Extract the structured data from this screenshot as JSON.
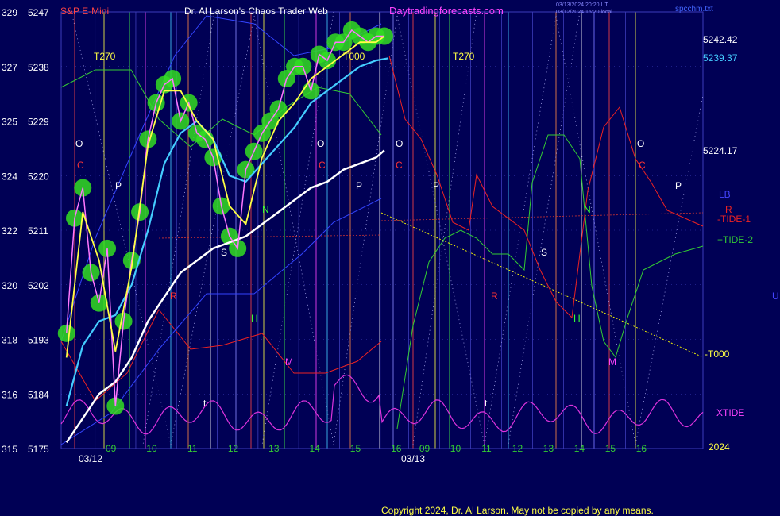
{
  "header": {
    "symbol": "S&P E-Mini",
    "title": "Dr. Al Larson's Chaos Trader Web",
    "site": "Daytradingforecasts.com",
    "timestamp_line1": "03/13/2024 20:20 UT",
    "timestamp_line2": "03/12/2024 16:20 local",
    "filename": "spcchm.txt"
  },
  "footer": {
    "copyright": "Copyright 2024, Dr. Al Larson. May not be copied by any means."
  },
  "colors": {
    "background": "#000055",
    "grid": "#3d3dbb",
    "price": "#ff77ff",
    "ma_fast": "#ffff44",
    "ma_mid": "#44ccff",
    "ma_slow": "#ffffff",
    "tide1": "#ee2222",
    "tide2": "#33cc33",
    "xtide": "#dd33dd",
    "t000": "#ffff00",
    "glow": "#33dd22",
    "axis_text": "#ffffff",
    "header_red": "#ff4444",
    "header_site": "#ff44ff"
  },
  "chart_data": {
    "type": "line",
    "title": "S&P E-Mini",
    "y_left_outer_ticks": [
      "329",
      "327",
      "325",
      "324",
      "322",
      "320",
      "318",
      "316",
      "315"
    ],
    "y_left_inner_ticks": [
      "5247",
      "5238",
      "5229",
      "5220",
      "5211",
      "5202",
      "5193",
      "5184",
      "5175"
    ],
    "ylim": [
      5175,
      5247
    ],
    "x_hour_ticks": [
      "09",
      "10",
      "11",
      "12",
      "13",
      "14",
      "15",
      "16",
      "09",
      "10",
      "11",
      "12",
      "13",
      "14",
      "15",
      "16"
    ],
    "x_date_labels": [
      "03/12",
      "03/13"
    ],
    "x_ticks_days": [
      {
        "date": "03/12",
        "hours": [
          9,
          10,
          11,
          12,
          13,
          14,
          15,
          16
        ]
      },
      {
        "date": "03/13",
        "hours": [
          9,
          10,
          11,
          12,
          13,
          14,
          15,
          16
        ]
      }
    ],
    "right_labels": [
      {
        "text": "5242.42",
        "value": 5242.42,
        "color": "#ffffff"
      },
      {
        "text": "5239.37",
        "value": 5239.37,
        "color": "#44ccff"
      },
      {
        "text": "5224.17",
        "value": 5224.17,
        "color": "#ffffff"
      },
      {
        "text": "LB",
        "color": "#4444ff"
      },
      {
        "text": "R",
        "color": "#ee2222"
      },
      {
        "text": "-TIDE-1",
        "color": "#ee2222"
      },
      {
        "text": "+TIDE-2",
        "color": "#33cc33"
      },
      {
        "text": "U",
        "color": "#4444ff"
      },
      {
        "text": "-T000",
        "color": "#ffff44"
      },
      {
        "text": "XTIDE",
        "color": "#ff44ff"
      },
      {
        "text": "2024",
        "color": "#ffff44"
      }
    ],
    "annotations": [
      {
        "text": "T270",
        "color": "#ffff44"
      },
      {
        "text": "T270",
        "color": "#ffff44"
      },
      {
        "text": "T000",
        "color": "#ffff44"
      },
      {
        "text": "O",
        "color": "#ffffff"
      },
      {
        "text": "C",
        "color": "#ff3333"
      },
      {
        "text": "P",
        "color": "#ffffff"
      },
      {
        "text": "R",
        "color": "#ff3333"
      },
      {
        "text": "S",
        "color": "#ffffff"
      },
      {
        "text": "N",
        "color": "#33ff33"
      },
      {
        "text": "H",
        "color": "#33ff33"
      },
      {
        "text": "M",
        "color": "#ff44ff"
      },
      {
        "text": "t",
        "color": "#ffffff"
      },
      {
        "text": "O",
        "color": "#ffffff"
      },
      {
        "text": "C",
        "color": "#ff3333"
      },
      {
        "text": "P",
        "color": "#ffffff"
      },
      {
        "text": "O",
        "color": "#ffffff"
      },
      {
        "text": "C",
        "color": "#ff3333"
      },
      {
        "text": "P",
        "color": "#ffffff"
      },
      {
        "text": "R",
        "color": "#ff3333"
      },
      {
        "text": "S",
        "color": "#ffffff"
      },
      {
        "text": "N",
        "color": "#33ff33"
      },
      {
        "text": "H",
        "color": "#33ff33"
      },
      {
        "text": "M",
        "color": "#ff44ff"
      },
      {
        "text": "t",
        "color": "#ffffff"
      },
      {
        "text": "O",
        "color": "#ffffff"
      },
      {
        "text": "C",
        "color": "#ff3333"
      },
      {
        "text": "P",
        "color": "#ffffff"
      }
    ],
    "series": [
      {
        "name": "Price",
        "x": [
          8.3,
          8.5,
          8.7,
          8.9,
          9.1,
          9.3,
          9.5,
          9.7,
          9.9,
          10.1,
          10.3,
          10.5,
          10.7,
          10.9,
          11.1,
          11.3,
          11.5,
          11.7,
          11.9,
          12.1,
          12.3,
          12.5,
          12.7,
          12.9,
          13.1,
          13.3,
          13.5,
          13.7,
          13.9,
          14.1,
          14.3,
          14.5,
          14.7,
          14.9,
          15.1,
          15.3,
          15.5,
          15.7,
          15.9,
          16.1
        ],
        "values": [
          5194,
          5213,
          5218,
          5204,
          5199,
          5208,
          5182,
          5196,
          5206,
          5214,
          5226,
          5232,
          5235,
          5236,
          5229,
          5232,
          5227,
          5226,
          5223,
          5215,
          5210,
          5208,
          5221,
          5224,
          5227,
          5229,
          5231,
          5236,
          5238,
          5238,
          5234,
          5240,
          5239,
          5242,
          5242,
          5244,
          5243,
          5242,
          5243,
          5243
        ]
      },
      {
        "name": "Fast MA",
        "x": [
          8.3,
          8.7,
          9.1,
          9.5,
          9.9,
          10.3,
          10.7,
          11.1,
          11.5,
          11.9,
          12.3,
          12.7,
          13.1,
          13.5,
          13.9,
          14.3,
          14.7,
          15.1,
          15.5,
          15.9,
          16.1
        ],
        "values": [
          5190,
          5214,
          5206,
          5191,
          5205,
          5225,
          5234,
          5234,
          5229,
          5226,
          5215,
          5212,
          5223,
          5229,
          5232,
          5236,
          5238,
          5240,
          5242,
          5242,
          5243
        ]
      },
      {
        "name": "Mid MA",
        "x": [
          8.3,
          8.7,
          9.1,
          9.5,
          9.9,
          10.3,
          10.7,
          11.1,
          11.5,
          11.9,
          12.3,
          12.7,
          13.1,
          13.5,
          13.9,
          14.3,
          14.7,
          15.1,
          15.5,
          15.9,
          16.2
        ],
        "values": [
          5182,
          5192,
          5196,
          5197,
          5202,
          5211,
          5222,
          5227,
          5229,
          5226,
          5220,
          5219,
          5222,
          5225,
          5228,
          5232,
          5234,
          5236,
          5238,
          5239,
          5239.37
        ]
      },
      {
        "name": "Slow MA",
        "x": [
          8.3,
          8.7,
          9.1,
          9.5,
          9.9,
          10.3,
          10.7,
          11.1,
          11.5,
          11.9,
          12.3,
          12.7,
          13.1,
          13.5,
          13.9,
          14.3,
          14.7,
          15.1,
          15.5,
          15.9,
          16.1
        ],
        "values": [
          5176,
          5180,
          5184,
          5186,
          5190,
          5196,
          5200,
          5204,
          5206,
          5208,
          5209,
          5210,
          5212,
          5214,
          5216,
          5218,
          5219,
          5221,
          5222,
          5223,
          5224.17
        ]
      }
    ]
  }
}
